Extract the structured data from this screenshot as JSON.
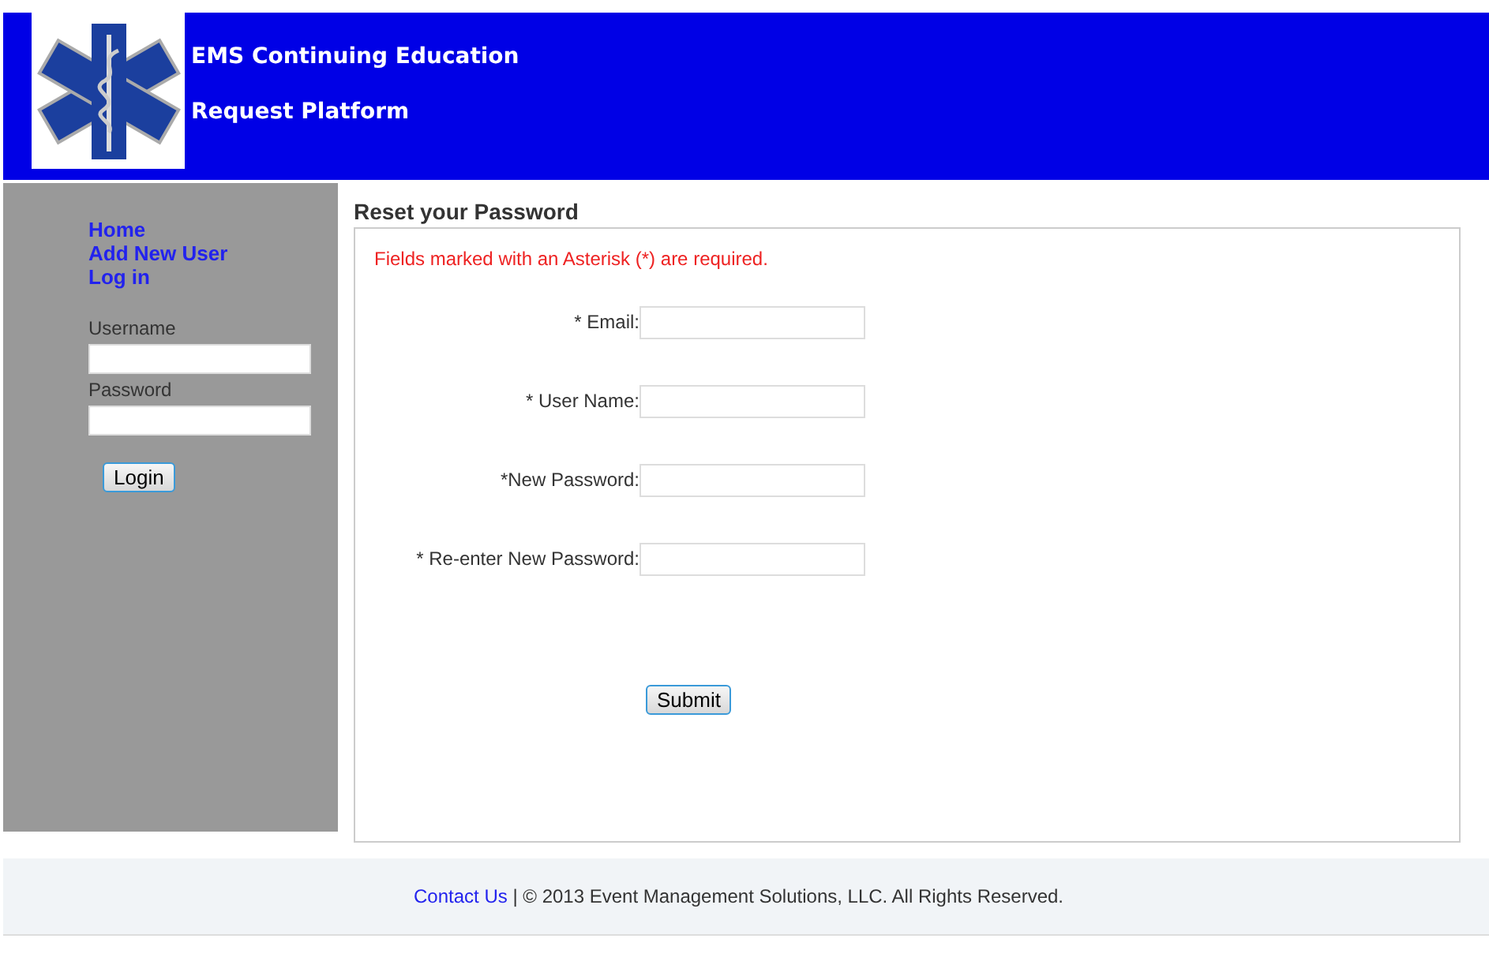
{
  "header": {
    "title_lines": [
      "EMS Continuing Education",
      "Request Platform"
    ]
  },
  "sidebar": {
    "links": [
      "Home",
      "Add New User",
      "Log in"
    ],
    "fields": [
      {
        "label": "Username"
      },
      {
        "label": "Password"
      }
    ],
    "button": "Login"
  },
  "main": {
    "heading": "Reset your Password",
    "notice": "Fields marked with an Asterisk (*) are required.",
    "fields": [
      {
        "label": "* Email:"
      },
      {
        "label": "* User Name:"
      },
      {
        "label": "*New Password:"
      },
      {
        "label": "* Re-enter New Password:"
      }
    ],
    "button": "Submit"
  },
  "footer": {
    "link": "Contact Us",
    "text": "| © 2013 Event Management Solutions, LLC. All Rights Reserved."
  }
}
